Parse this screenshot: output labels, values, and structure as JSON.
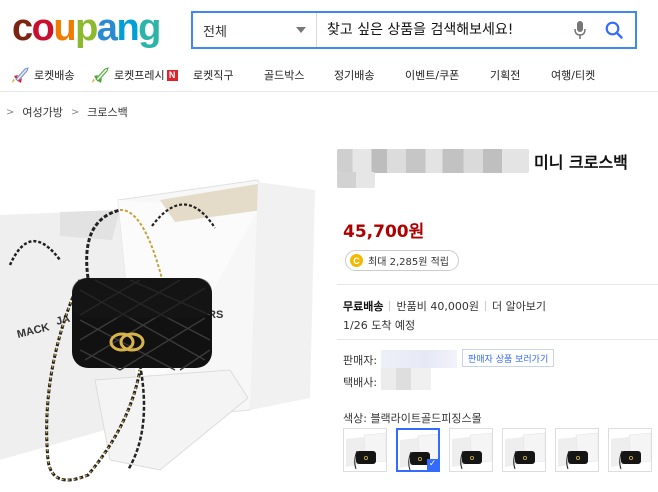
{
  "header": {
    "logo": [
      "c",
      "o",
      "u",
      "p",
      "a",
      "n",
      "g"
    ],
    "logo_colors": [
      "#7a2412",
      "#c8102e",
      "#ef7c00",
      "#8db92e",
      "#2a8bd3",
      "#00a0d6",
      "#2bb5a9"
    ],
    "search_category": "전체",
    "search_placeholder": "찾고 싶은 상품을 검색해보세요!",
    "search_border_color": "#4285f4"
  },
  "nav": [
    {
      "label": "로켓배송",
      "icon": "rocket-icon"
    },
    {
      "label": "로켓프레시",
      "icon": "rocket-fresh-icon",
      "badge": "N"
    },
    {
      "label": "로켓직구"
    },
    {
      "label": "골드박스"
    },
    {
      "label": "정기배송"
    },
    {
      "label": "이벤트/쿠폰"
    },
    {
      "label": "기획전"
    },
    {
      "label": "여행/티켓"
    }
  ],
  "breadcrumb": [
    "여성가방",
    "크로스백"
  ],
  "product": {
    "title_suffix": "미니 크로스백",
    "price": "45,700원",
    "price_color": "#ae0000",
    "reward_text": "최대 2,285원 적립",
    "shipping_type": "무료배송",
    "return_fee": "반품비 40,000원",
    "more_link": "더 알아보기",
    "delivery_eta": "1/26 도착 예정",
    "seller_label": "판매자:",
    "seller_button": "판매자 상품 보러가기",
    "courier_label": "택배사:",
    "color_label": "색상: 블랙라이트골드피징스몰",
    "option_selected_index": 1,
    "option_count": 6,
    "accent_color": "#346aff"
  }
}
